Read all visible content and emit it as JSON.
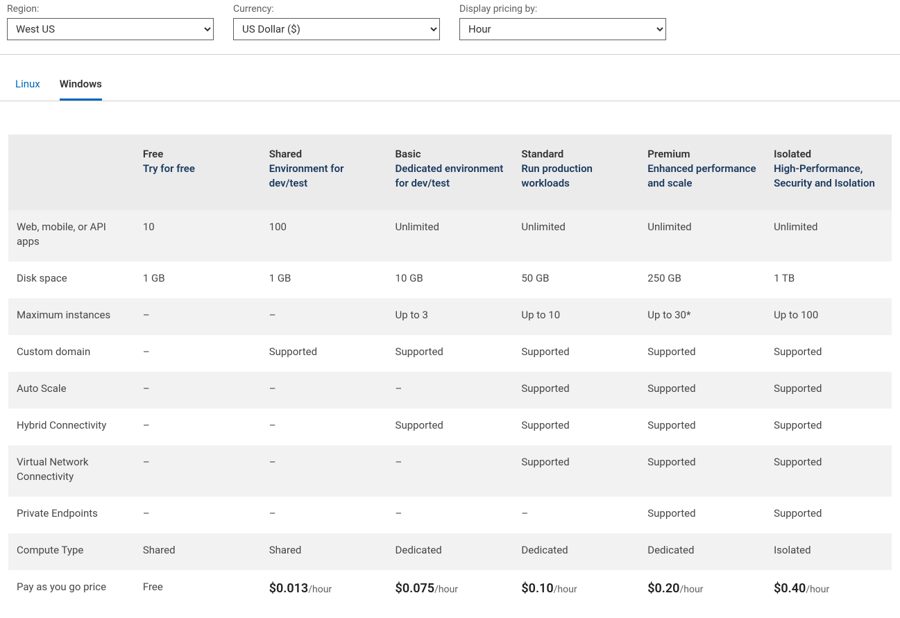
{
  "filters": {
    "region": {
      "label": "Region:",
      "value": "West US"
    },
    "currency": {
      "label": "Currency:",
      "value": "US Dollar ($)"
    },
    "display": {
      "label": "Display pricing by:",
      "value": "Hour"
    }
  },
  "tabs": [
    {
      "id": "linux",
      "label": "Linux",
      "active": false
    },
    {
      "id": "windows",
      "label": "Windows",
      "active": true
    }
  ],
  "table": {
    "columns": [
      {
        "title": "",
        "sub": ""
      },
      {
        "title": "Free",
        "sub": "Try for free"
      },
      {
        "title": "Shared",
        "sub": "Environment for dev/test"
      },
      {
        "title": "Basic",
        "sub": "Dedicated environment for dev/test"
      },
      {
        "title": "Standard",
        "sub": "Run production workloads"
      },
      {
        "title": "Premium",
        "sub": "Enhanced performance and scale"
      },
      {
        "title": "Isolated",
        "sub": "High-Performance, Security and Isolation"
      }
    ],
    "rows": [
      {
        "label": "Web, mobile, or API apps",
        "cells": [
          "10",
          "100",
          "Unlimited",
          "Unlimited",
          "Unlimited",
          "Unlimited"
        ]
      },
      {
        "label": "Disk space",
        "cells": [
          "1 GB",
          "1 GB",
          "10 GB",
          "50 GB",
          "250 GB",
          "1 TB"
        ]
      },
      {
        "label": "Maximum instances",
        "cells": [
          "–",
          "–",
          "Up to 3",
          "Up to 10",
          "Up to 30*",
          "Up to 100"
        ]
      },
      {
        "label": "Custom domain",
        "cells": [
          "–",
          "Supported",
          "Supported",
          "Supported",
          "Supported",
          "Supported"
        ]
      },
      {
        "label": "Auto Scale",
        "cells": [
          "–",
          "–",
          "–",
          "Supported",
          "Supported",
          "Supported"
        ]
      },
      {
        "label": "Hybrid Connectivity",
        "cells": [
          "–",
          "–",
          "Supported",
          "Supported",
          "Supported",
          "Supported"
        ]
      },
      {
        "label": "Virtual Network Connectivity",
        "cells": [
          "–",
          "–",
          "–",
          "Supported",
          "Supported",
          "Supported"
        ]
      },
      {
        "label": "Private Endpoints",
        "cells": [
          "–",
          "–",
          "–",
          "–",
          "Supported",
          "Supported"
        ]
      },
      {
        "label": "Compute Type",
        "cells": [
          "Shared",
          "Shared",
          "Dedicated",
          "Dedicated",
          "Dedicated",
          "Isolated"
        ]
      }
    ],
    "price_row": {
      "label": "Pay as you go price",
      "cells": [
        {
          "amount": "Free",
          "unit": ""
        },
        {
          "amount": "$0.013",
          "unit": "/hour"
        },
        {
          "amount": "$0.075",
          "unit": "/hour"
        },
        {
          "amount": "$0.10",
          "unit": "/hour"
        },
        {
          "amount": "$0.20",
          "unit": "/hour"
        },
        {
          "amount": "$0.40",
          "unit": "/hour"
        }
      ]
    }
  }
}
